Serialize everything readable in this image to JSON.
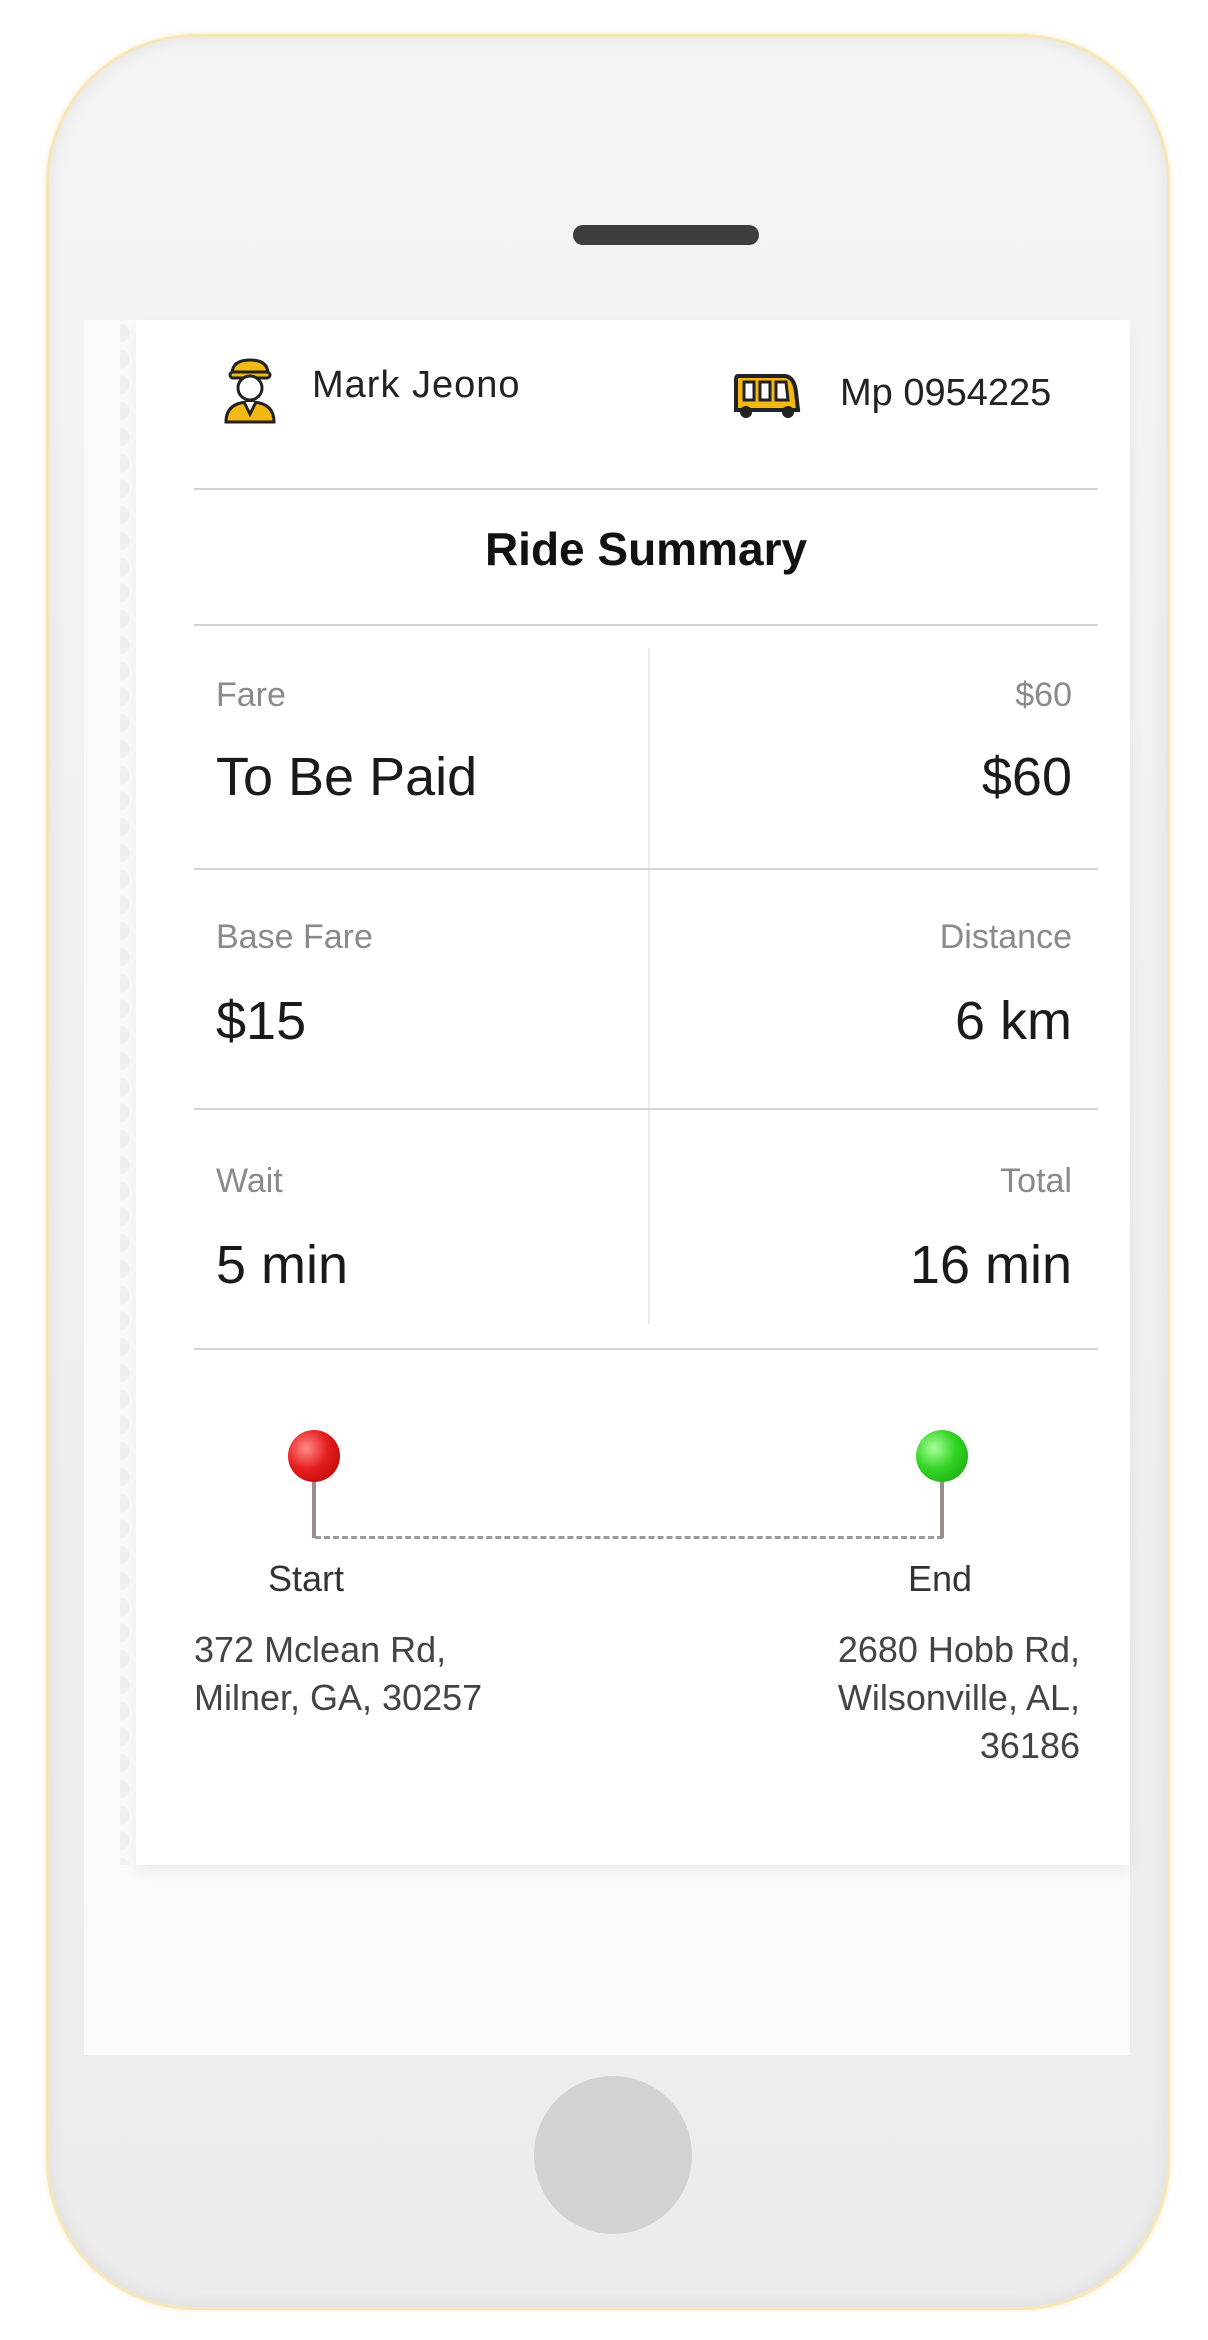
{
  "header": {
    "driver_name": "Mark Jeono",
    "vehicle_number": "Mp 0954225"
  },
  "summary": {
    "title": "Ride Summary",
    "rows": [
      {
        "left_label": "Fare",
        "left_value": "To Be Paid",
        "right_label": "$60",
        "right_value": "$60"
      },
      {
        "left_label": "Base Fare",
        "left_value": "$15",
        "right_label": "Distance",
        "right_value": "6 km"
      },
      {
        "left_label": "Wait",
        "left_value": "5 min",
        "right_label": "Total",
        "right_value": "16 min"
      }
    ]
  },
  "route": {
    "start_label": "Start",
    "start_address": "372 Mclean Rd,\nMilner, GA, 30257",
    "end_label": "End",
    "end_address": "2680 Hobb Rd,\nWilsonville, AL,\n36186"
  },
  "colors": {
    "start_pin": "#e51e1e",
    "end_pin": "#32d424",
    "driver_icon": "#f3b813"
  }
}
